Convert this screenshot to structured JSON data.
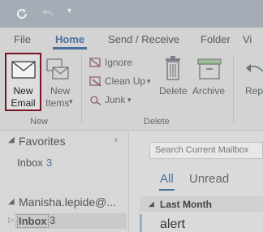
{
  "ribbon_tabs": [
    "File",
    "Home",
    "Send / Receive",
    "Folder",
    "Vi"
  ],
  "new_group": {
    "new_email_line1": "New",
    "new_email_line2": "Email",
    "new_items_line1": "New",
    "new_items_line2": "Items",
    "label": "New"
  },
  "delete_group": {
    "ignore": "Ignore",
    "clean_up": "Clean Up",
    "junk": "Junk",
    "delete": "Delete",
    "archive": "Archive",
    "label": "Delete"
  },
  "respond_group": {
    "reply": "Repl"
  },
  "nav": {
    "collapse_glyph": "‹",
    "favorites_header": "Favorites",
    "favorites_inbox": "Inbox",
    "favorites_inbox_count": "3",
    "account_header": "Manisha.lepide@...",
    "account_inbox": "Inbox",
    "account_inbox_count": "3"
  },
  "list": {
    "search_placeholder": "Search Current Mailbox",
    "filter_all": "All",
    "filter_unread": "Unread",
    "group_header": "Last Month",
    "message_subject": "alert"
  },
  "colors": {
    "accent": "#4a6f9d",
    "highlight_border": "#7a1525"
  }
}
